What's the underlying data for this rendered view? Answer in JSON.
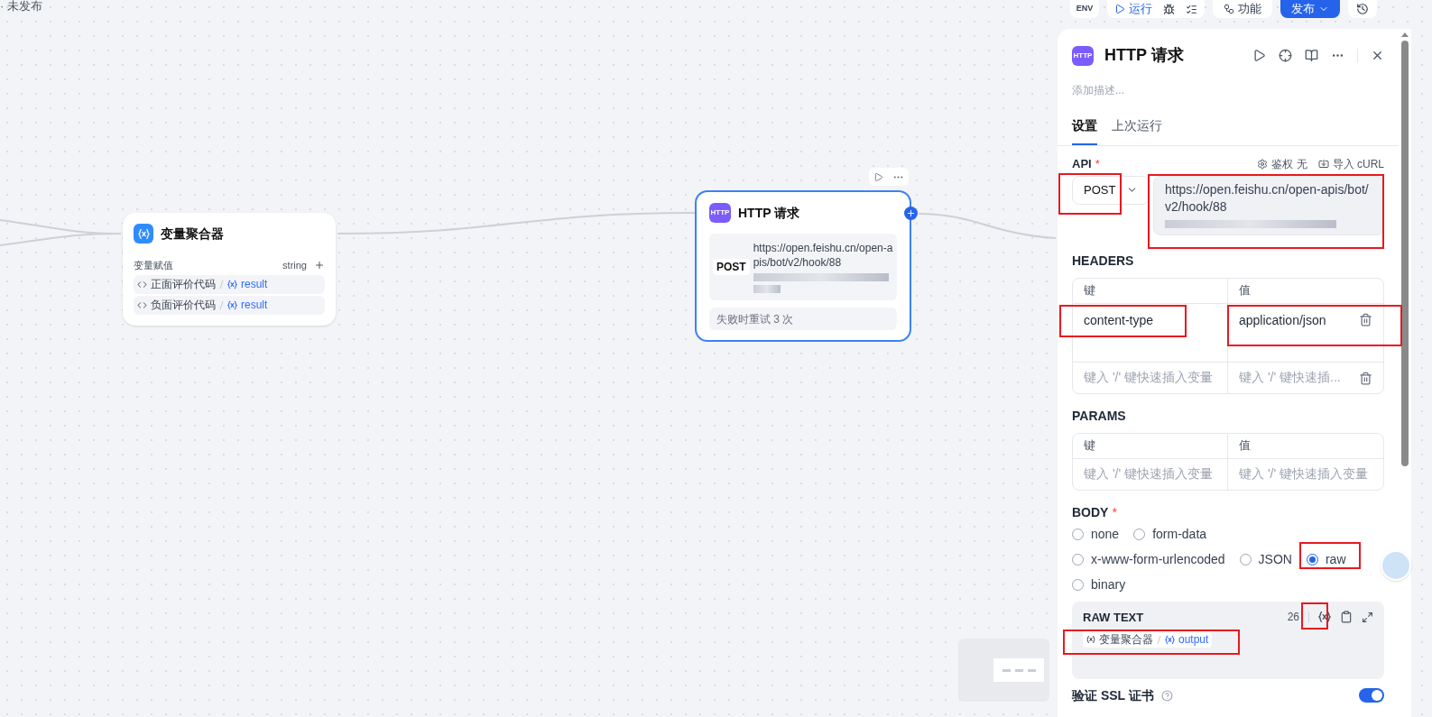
{
  "status": "· 未发布",
  "toolbar": {
    "env": "ENV",
    "run": "运行",
    "features": "功能",
    "publish": "发布"
  },
  "aggregator_node": {
    "title": "变量聚合器",
    "section": "变量赋值",
    "type": "string",
    "rows": [
      {
        "source": "正面评价代码",
        "variable": "result"
      },
      {
        "source": "负面评价代码",
        "variable": "result"
      }
    ]
  },
  "http_node": {
    "icon_label": "HTTP",
    "title": "HTTP 请求",
    "method": "POST",
    "url": "https://open.feishu.cn/open-apis/bot/v2/hook/88",
    "retry": "失败时重试 3 次"
  },
  "panel": {
    "icon_label": "HTTP",
    "title": "HTTP 请求",
    "description_placeholder": "添加描述...",
    "tabs": [
      {
        "label": "设置",
        "selected": true
      },
      {
        "label": "上次运行",
        "selected": false
      }
    ],
    "api": {
      "label": "API",
      "required_mark": "*",
      "auth": "鉴权 无",
      "import": "导入 cURL",
      "method": "POST",
      "url": "https://open.feishu.cn/open-apis/bot/v2/hook/88"
    },
    "headers": {
      "title": "HEADERS",
      "columns": [
        "键",
        "值"
      ],
      "rows": [
        {
          "key": "content-type",
          "value": "application/json"
        },
        {
          "key_placeholder": "键入 '/' 键快速插入变量",
          "value_placeholder": "键入 '/' 键快速插..."
        }
      ]
    },
    "params": {
      "title": "PARAMS",
      "columns": [
        "键",
        "值"
      ],
      "rows": [
        {
          "key_placeholder": "键入 '/' 键快速插入变量",
          "value_placeholder": "键入 '/' 键快速插入变量"
        }
      ]
    },
    "body": {
      "title": "BODY",
      "required_mark": "*",
      "option_rows": [
        [
          {
            "label": "none",
            "selected": false
          },
          {
            "label": "form-data",
            "selected": false
          }
        ],
        [
          {
            "label": "x-www-form-urlencoded",
            "selected": false
          },
          {
            "label": "JSON",
            "selected": false
          },
          {
            "label": "raw",
            "selected": true
          }
        ],
        [
          {
            "label": "binary",
            "selected": false
          }
        ]
      ],
      "raw_text": {
        "title": "RAW TEXT",
        "count": "26",
        "chips": [
          {
            "source": "变量聚合器",
            "variable": "output"
          }
        ]
      }
    },
    "ssl": {
      "label": "验证 SSL 证书",
      "on": true
    }
  }
}
